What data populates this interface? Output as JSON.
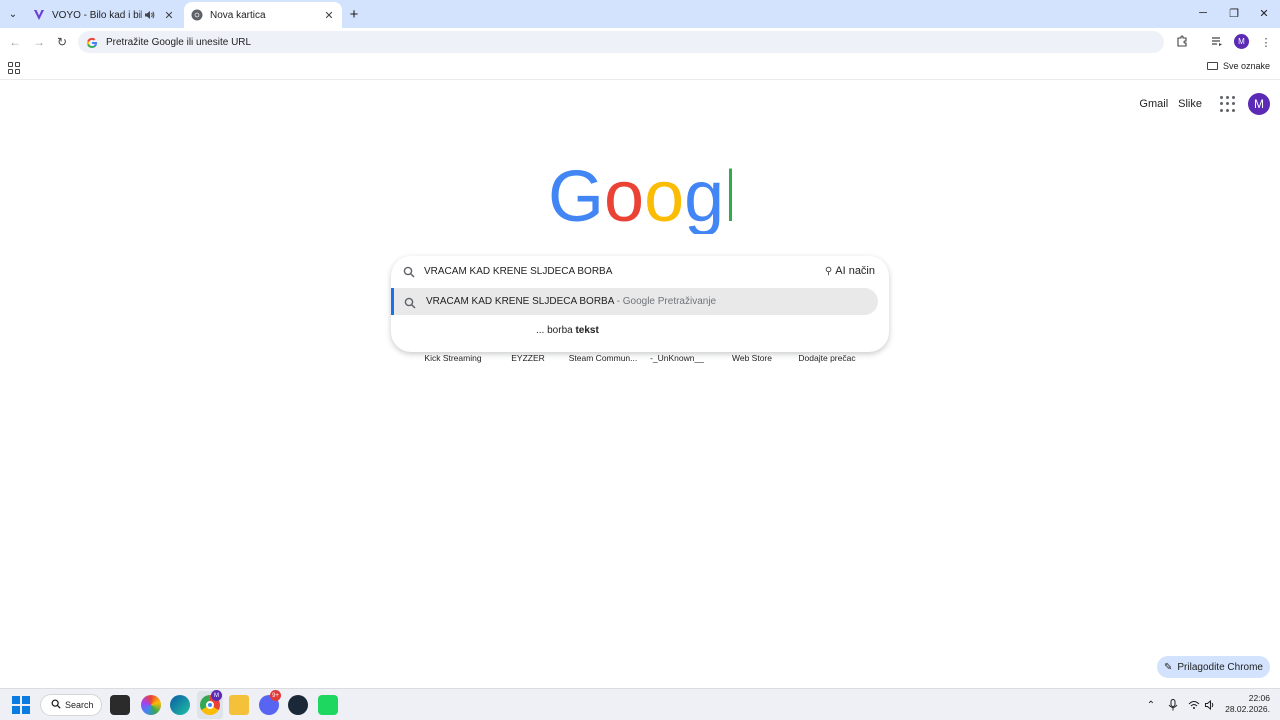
{
  "tabs": [
    {
      "title": "VOYO - Bilo kad i bilo gdje",
      "favicon": "voyo-logo",
      "audio": true,
      "active": false
    },
    {
      "title": "Nova kartica",
      "favicon": "chrome-icon",
      "audio": false,
      "active": true
    }
  ],
  "toolbar": {
    "omnibox_placeholder": "Pretražite Google ili unesite URL",
    "profile_initial": "M"
  },
  "bookmarks_bar": {
    "all_bookmarks": "Sve oznake"
  },
  "header_links": {
    "gmail": "Gmail",
    "images": "Slike",
    "avatar_initial": "M"
  },
  "search": {
    "query": "VRACAM KAD KRENE SLJDECA BORBA",
    "ai_mode": "AI način",
    "suggestions": [
      {
        "text": "VRACAM KAD KRENE SLJDECA BORBA",
        "suffix": " - Google Pretraživanje"
      },
      {
        "prefix": "... borba ",
        "bold": "tekst"
      }
    ]
  },
  "shortcuts": [
    "Kick Streaming",
    "EYZZER",
    "Steam Commun...",
    "-_UnKnown__",
    "Web Store",
    "Dodajte prečac"
  ],
  "customize_chrome": "Prilagodite Chrome",
  "taskbar": {
    "search_label": "Search",
    "chrome_badge": "M",
    "discord_badge": "9+",
    "time": "22:06",
    "date": "28.02.2026."
  },
  "colors": {
    "tabstrip": "#d3e3fd",
    "accent": "#1a73e8",
    "profile": "#5b2bb5",
    "suggestion_highlight": "#e9e9ea"
  }
}
